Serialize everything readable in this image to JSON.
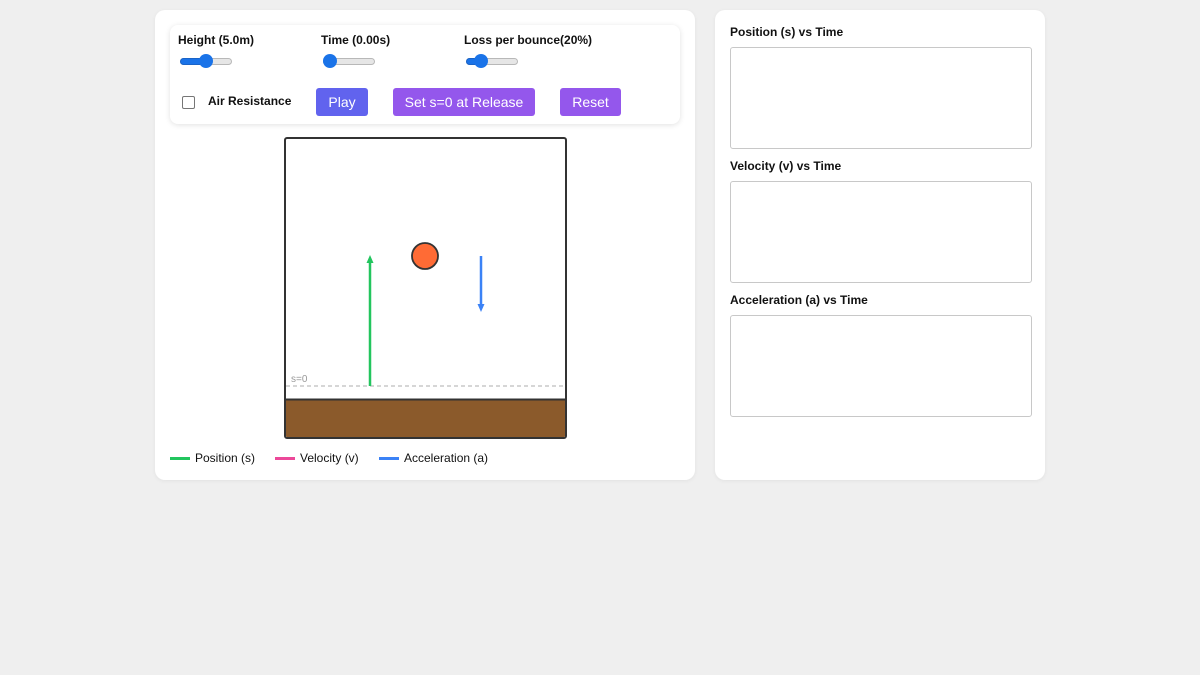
{
  "controls": {
    "height_label": "Height (5.0m)",
    "height_value": 5.0,
    "time_label": "Time (0.00s)",
    "time_value": 0.0,
    "loss_label": "Loss per bounce(20%)",
    "loss_value": 20,
    "air_resistance_label": "Air Resistance",
    "air_resistance_checked": false,
    "play_label": "Play",
    "set_zero_label": "Set s=0 at Release",
    "reset_label": "Reset"
  },
  "simulation": {
    "zero_label": "s=0",
    "ball_color": "#ff6b35",
    "ground_color": "#8b5a2b",
    "position_vector_color": "#22c55e",
    "acceleration_vector_color": "#3b82f6"
  },
  "legend": [
    {
      "label": "Position (s)",
      "color": "#22c55e"
    },
    {
      "label": "Velocity (v)",
      "color": "#ec4899"
    },
    {
      "label": "Acceleration (a)",
      "color": "#3b82f6"
    }
  ],
  "graphs": {
    "position_title": "Position (s) vs Time",
    "velocity_title": "Velocity (v) vs Time",
    "acceleration_title": "Acceleration (a) vs Time"
  }
}
